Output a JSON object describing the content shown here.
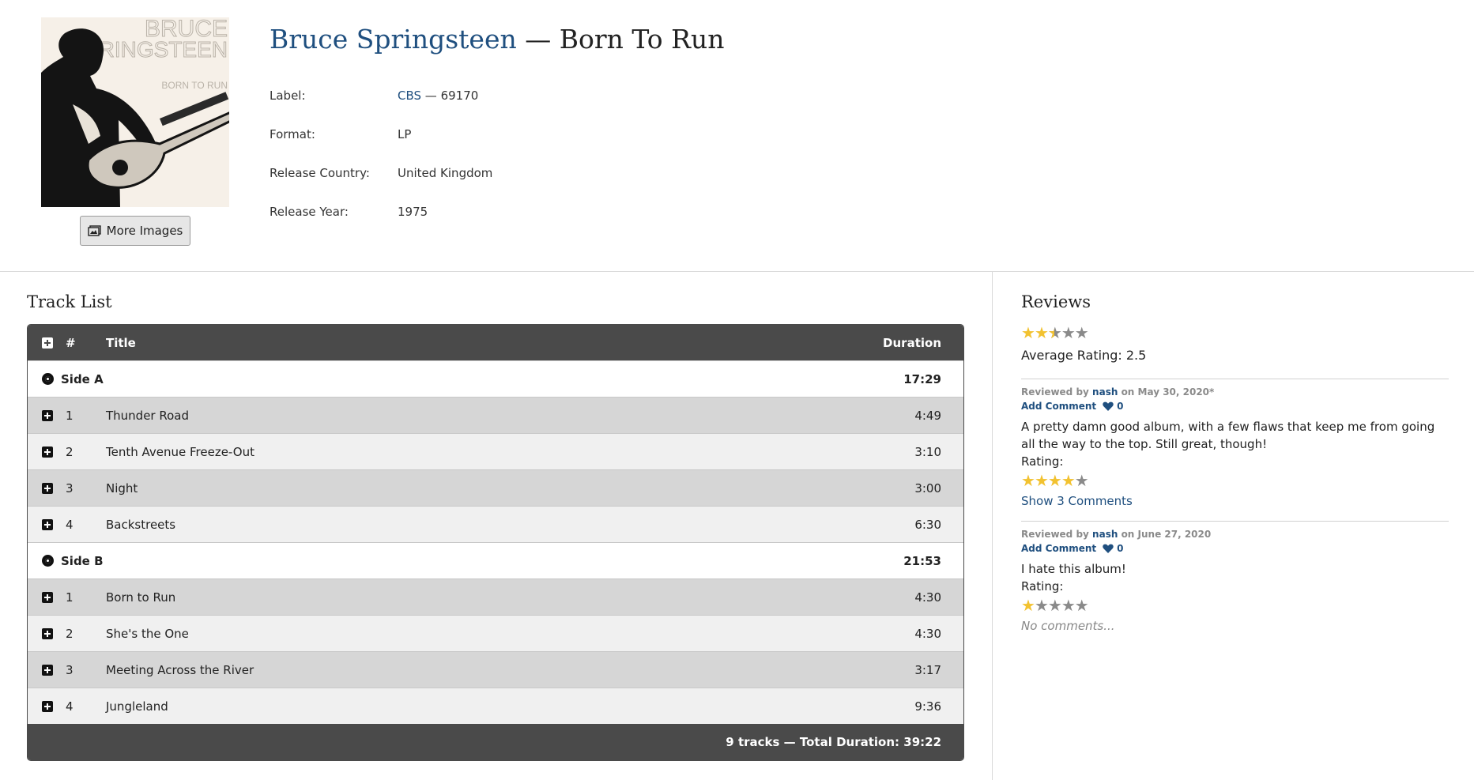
{
  "album": {
    "artist": "Bruce Springsteen",
    "separator": " — ",
    "title": "Born To Run",
    "cover_text_line1": "BRUCE",
    "cover_text_line2": "SPRINGSTEEN",
    "cover_text_line3": "BORN TO RUN",
    "more_images_label": "More Images"
  },
  "meta": {
    "label_label": "Label:",
    "label_link": "CBS",
    "label_sep": " — ",
    "label_catalog": "69170",
    "format_label": "Format:",
    "format_value": "LP",
    "country_label": "Release Country:",
    "country_value": "United Kingdom",
    "year_label": "Release Year:",
    "year_value": "1975"
  },
  "tracklist": {
    "section_title": "Track List",
    "head_num": "#",
    "head_title": "Title",
    "head_duration": "Duration",
    "sides": [
      {
        "name": "Side A",
        "duration": "17:29",
        "tracks": [
          {
            "num": "1",
            "title": "Thunder Road",
            "duration": "4:49"
          },
          {
            "num": "2",
            "title": "Tenth Avenue Freeze-Out",
            "duration": "3:10"
          },
          {
            "num": "3",
            "title": "Night",
            "duration": "3:00"
          },
          {
            "num": "4",
            "title": "Backstreets",
            "duration": "6:30"
          }
        ]
      },
      {
        "name": "Side B",
        "duration": "21:53",
        "tracks": [
          {
            "num": "1",
            "title": "Born to Run",
            "duration": "4:30"
          },
          {
            "num": "2",
            "title": "She's the One",
            "duration": "4:30"
          },
          {
            "num": "3",
            "title": "Meeting Across the River",
            "duration": "3:17"
          },
          {
            "num": "4",
            "title": "Jungleland",
            "duration": "9:36"
          }
        ]
      }
    ],
    "footer": "9 tracks — Total Duration: 39:22"
  },
  "reviews": {
    "section_title": "Reviews",
    "average_stars": 2.5,
    "average_label": "Average Rating: 2.5",
    "items": [
      {
        "reviewed_by": "Reviewed by",
        "user": "nash",
        "date": "on May 30, 2020*",
        "add_comment": "Add Comment",
        "likes": "0",
        "text": "A pretty damn good album, with a few flaws that keep me from going all the way to the top. Still great, though!",
        "rating_label": "Rating:",
        "stars": 4,
        "comments": "Show 3 Comments"
      },
      {
        "reviewed_by": "Reviewed by",
        "user": "nash",
        "date": "on June 27, 2020",
        "add_comment": "Add Comment",
        "likes": "0",
        "text": "I hate this album!",
        "rating_label": "Rating:",
        "stars": 1,
        "comments": "No comments..."
      }
    ]
  },
  "colors": {
    "link": "#1f4f7f",
    "table_header": "#4a4a4a",
    "row_dark": "#d6d6d6",
    "row_light": "#f0f0f0",
    "star_on": "#f2c230",
    "star_off": "#8a8a8a"
  },
  "icons": {
    "expand": "plus-square-icon",
    "side": "vinyl-disc-icon",
    "images": "images-icon",
    "like": "heart-icon",
    "star": "star-icon"
  }
}
